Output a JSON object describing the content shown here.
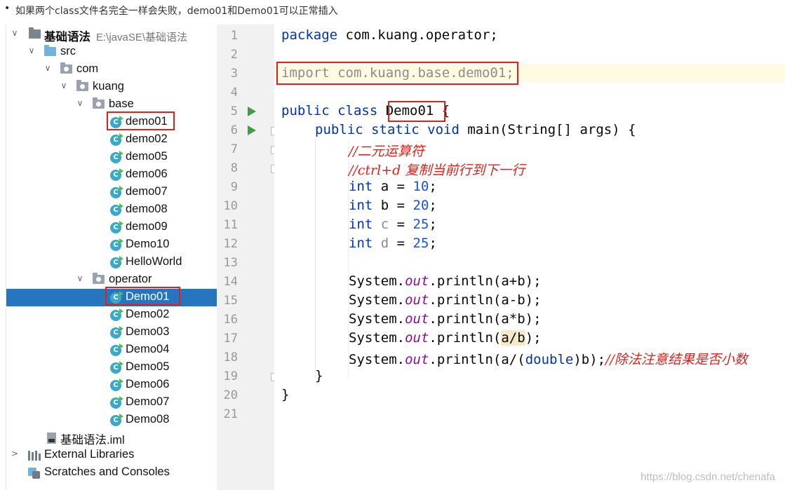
{
  "note": {
    "bullet": "•",
    "text": "如果两个class文件名完全一样会失败，demo01和Demo01可以正常插入"
  },
  "project": {
    "name": "基础语法",
    "path": "E:\\javaSE\\基础语法",
    "src": "src",
    "com": "com",
    "kuang": "kuang",
    "base": "base",
    "base_classes": [
      "demo01",
      "demo02",
      "demo05",
      "demo06",
      "demo07",
      "demo08",
      "demo09",
      "Demo10",
      "HelloWorld"
    ],
    "operator": "operator",
    "operator_classes": [
      "Demo01",
      "Demo02",
      "Demo03",
      "Demo04",
      "Demo05",
      "Demo06",
      "Demo07",
      "Demo08"
    ],
    "iml": "基础语法.iml",
    "external_libraries": "External Libraries",
    "scratches": "Scratches and Consoles",
    "selected": "Demo01"
  },
  "icons": {
    "class": "C",
    "arrow_open": "∨",
    "arrow_closed": ">"
  },
  "colors": {
    "selection": "#2675bf",
    "highlight_box": "#e0201a",
    "keyword": "#0033b3",
    "comment": "#e0201a",
    "run": "#3f9d4a"
  },
  "editor": {
    "line_numbers": [
      "1",
      "2",
      "3",
      "4",
      "5",
      "6",
      "7",
      "8",
      "9",
      "10",
      "11",
      "12",
      "13",
      "14",
      "15",
      "16",
      "17",
      "18",
      "19",
      "20",
      "21"
    ],
    "code": {
      "l1_kw": "package",
      "l1_rest": " com.kuang.operator;",
      "l3": "import com.kuang.base.demo01",
      "l3_semi": ";",
      "l5_kw": "public class ",
      "l5_name": "Demo01",
      "l5_rest": " {",
      "l6_kw": "public static void ",
      "l6_rest": "main(String[] args) {",
      "l7": "//二元运算符",
      "l8": "//ctrl+d 复制当前行到下一行",
      "int_kw": "int",
      "l9_var": " a = ",
      "l9_val": "10",
      "l10_var": " b = ",
      "l10_val": "20",
      "l11_var": " c",
      "l11_eq": " = ",
      "l11_val": "25",
      "l12_var": " d",
      "l12_eq": " = ",
      "l12_val": "25",
      "semi": ";",
      "system": "System.",
      "out": "out",
      "l14_rest": ".println(a+b);",
      "l15_rest": ".println(a-b);",
      "l16_rest": ".println(a*b);",
      "l17_pre": ".println(",
      "l17_mid": "a/b",
      "l17_post": ");",
      "l18_pre": ".println(a/(",
      "l18_kw": "double",
      "l18_post": ")b);",
      "l18_cm": "//除法注意结果是否小数",
      "close_inner": "}",
      "close_outer": "}"
    }
  },
  "watermark": "https://blog.csdn.net/chenafa"
}
